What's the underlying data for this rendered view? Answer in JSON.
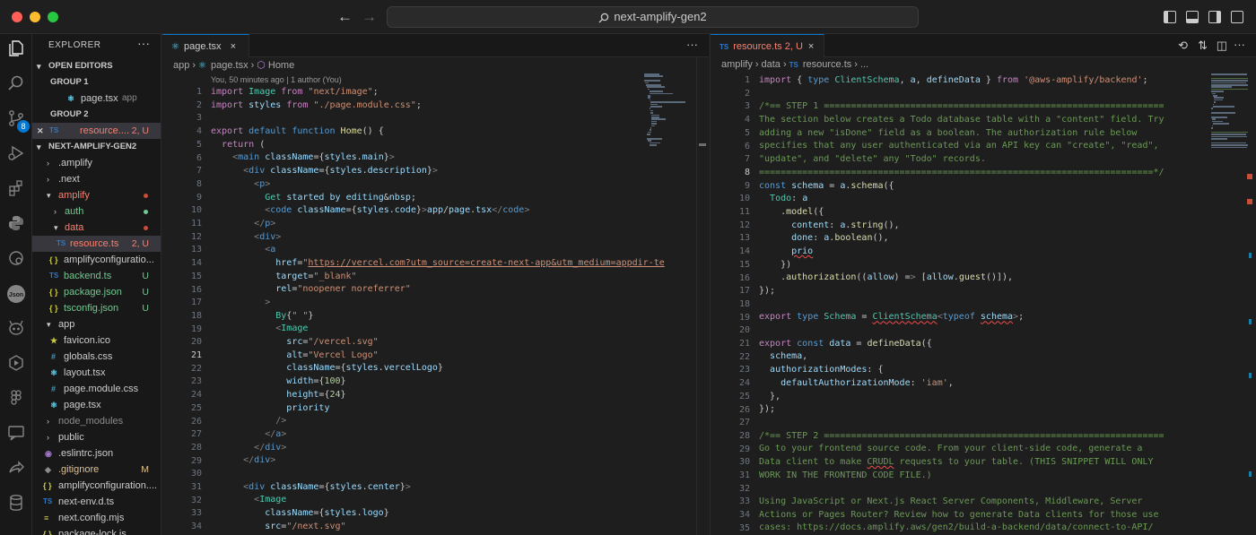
{
  "window": {
    "title": "next-amplify-gen2",
    "nav_back": "←",
    "nav_forward": "→"
  },
  "activity": {
    "scm_badge": "8"
  },
  "explorer": {
    "title": "EXPLORER",
    "more": "···",
    "open_editors_label": "OPEN EDITORS",
    "group1": "GROUP 1",
    "group2": "GROUP 2",
    "open_files": [
      {
        "name": "page.tsx",
        "detail": "app"
      },
      {
        "name": "resource....",
        "status": "2, U"
      }
    ],
    "project": "NEXT-AMPLIFY-GEN2",
    "tree": [
      {
        "name": ".amplify"
      },
      {
        "name": ".next"
      },
      {
        "name": "amplify"
      },
      {
        "name": "auth"
      },
      {
        "name": "data"
      },
      {
        "name": "resource.ts",
        "status": "2, U"
      },
      {
        "name": "amplifyconfiguratio..."
      },
      {
        "name": "backend.ts",
        "status": "U"
      },
      {
        "name": "package.json",
        "status": "U"
      },
      {
        "name": "tsconfig.json",
        "status": "U"
      },
      {
        "name": "app"
      },
      {
        "name": "favicon.ico"
      },
      {
        "name": "globals.css"
      },
      {
        "name": "layout.tsx"
      },
      {
        "name": "page.module.css"
      },
      {
        "name": "page.tsx"
      },
      {
        "name": "node_modules"
      },
      {
        "name": "public"
      },
      {
        "name": ".eslintrc.json"
      },
      {
        "name": ".gitignore",
        "status": "M"
      },
      {
        "name": "amplifyconfiguration...."
      },
      {
        "name": "next-env.d.ts"
      },
      {
        "name": "next.config.mjs"
      },
      {
        "name": "package-lock.js..."
      }
    ],
    "badge_ts": "TS",
    "badge_json": "{ }",
    "badge_css": "#"
  },
  "editor_left": {
    "tab_label": "page.tsx",
    "close": "×",
    "more": "···",
    "breadcrumb": [
      "app",
      "page.tsx",
      "Home"
    ],
    "blame": "You, 50 minutes ago | 1 author (You)",
    "current_line": "21",
    "lines": [
      "import Image from \"next/image\";",
      "import styles from \"./page.module.css\";",
      "",
      "export default function Home() {",
      "  return (",
      "    <main className={styles.main}>",
      "      <div className={styles.description}>",
      "        <p>",
      "          Get started by editing&nbsp;",
      "          <code className={styles.code}>app/page.tsx</code>",
      "        </p>",
      "        <div>",
      "          <a",
      "            href=\"https://vercel.com?utm_source=create-next-app&utm_medium=appdir-te",
      "            target=\"_blank\"",
      "            rel=\"noopener noreferrer\"",
      "          >",
      "            By{\" \"}",
      "            <Image",
      "              src=\"/vercel.svg\"",
      "              alt=\"Vercel Logo\"",
      "              className={styles.vercelLogo}",
      "              width={100}",
      "              height={24}",
      "              priority",
      "            />",
      "          </a>",
      "        </div>",
      "      </div>",
      "",
      "      <div className={styles.center}>",
      "        <Image",
      "          className={styles.logo}",
      "          src=\"/next.svg\""
    ]
  },
  "editor_right": {
    "tab_label": "resource.ts",
    "tab_status": "2, U",
    "close": "×",
    "breadcrumb": [
      "amplify",
      "data",
      "resource.ts",
      "..."
    ],
    "current_line": "8",
    "lines": [
      "import { type ClientSchema, a, defineData } from '@aws-amplify/backend';",
      "",
      "/*== STEP 1 ===============================================================",
      "The section below creates a Todo database table with a \"content\" field. Try",
      "adding a new \"isDone\" field as a boolean. The authorization rule below",
      "specifies that any user authenticated via an API key can \"create\", \"read\",",
      "\"update\", and \"delete\" any \"Todo\" records.",
      "=========================================================================*/",
      "const schema = a.schema({",
      "  Todo: a",
      "    .model({",
      "      content: a.string(),",
      "      done: a.boolean(),",
      "      prio",
      "    })",
      "    .authorization((allow) => [allow.guest()]),",
      "});",
      "",
      "export type Schema = ClientSchema<typeof schema>;",
      "",
      "export const data = defineData({",
      "  schema,",
      "  authorizationModes: {",
      "    defaultAuthorizationMode: 'iam',",
      "  },",
      "});",
      "",
      "/*== STEP 2 ===============================================================",
      "Go to your frontend source code. From your client-side code, generate a",
      "Data client to make CRUDL requests to your table. (THIS SNIPPET WILL ONLY",
      "WORK IN THE FRONTEND CODE FILE.)",
      "",
      "Using JavaScript or Next.js React Server Components, Middleware, Server",
      "Actions or Pages Router? Review how to generate Data clients for those use",
      "cases: https://docs.amplify.aws/gen2/build-a-backend/data/connect-to-API/"
    ]
  },
  "colors": {
    "accent": "#0078d4",
    "modified": "#e2c08d",
    "untracked": "#73c991",
    "error": "#f88070"
  }
}
